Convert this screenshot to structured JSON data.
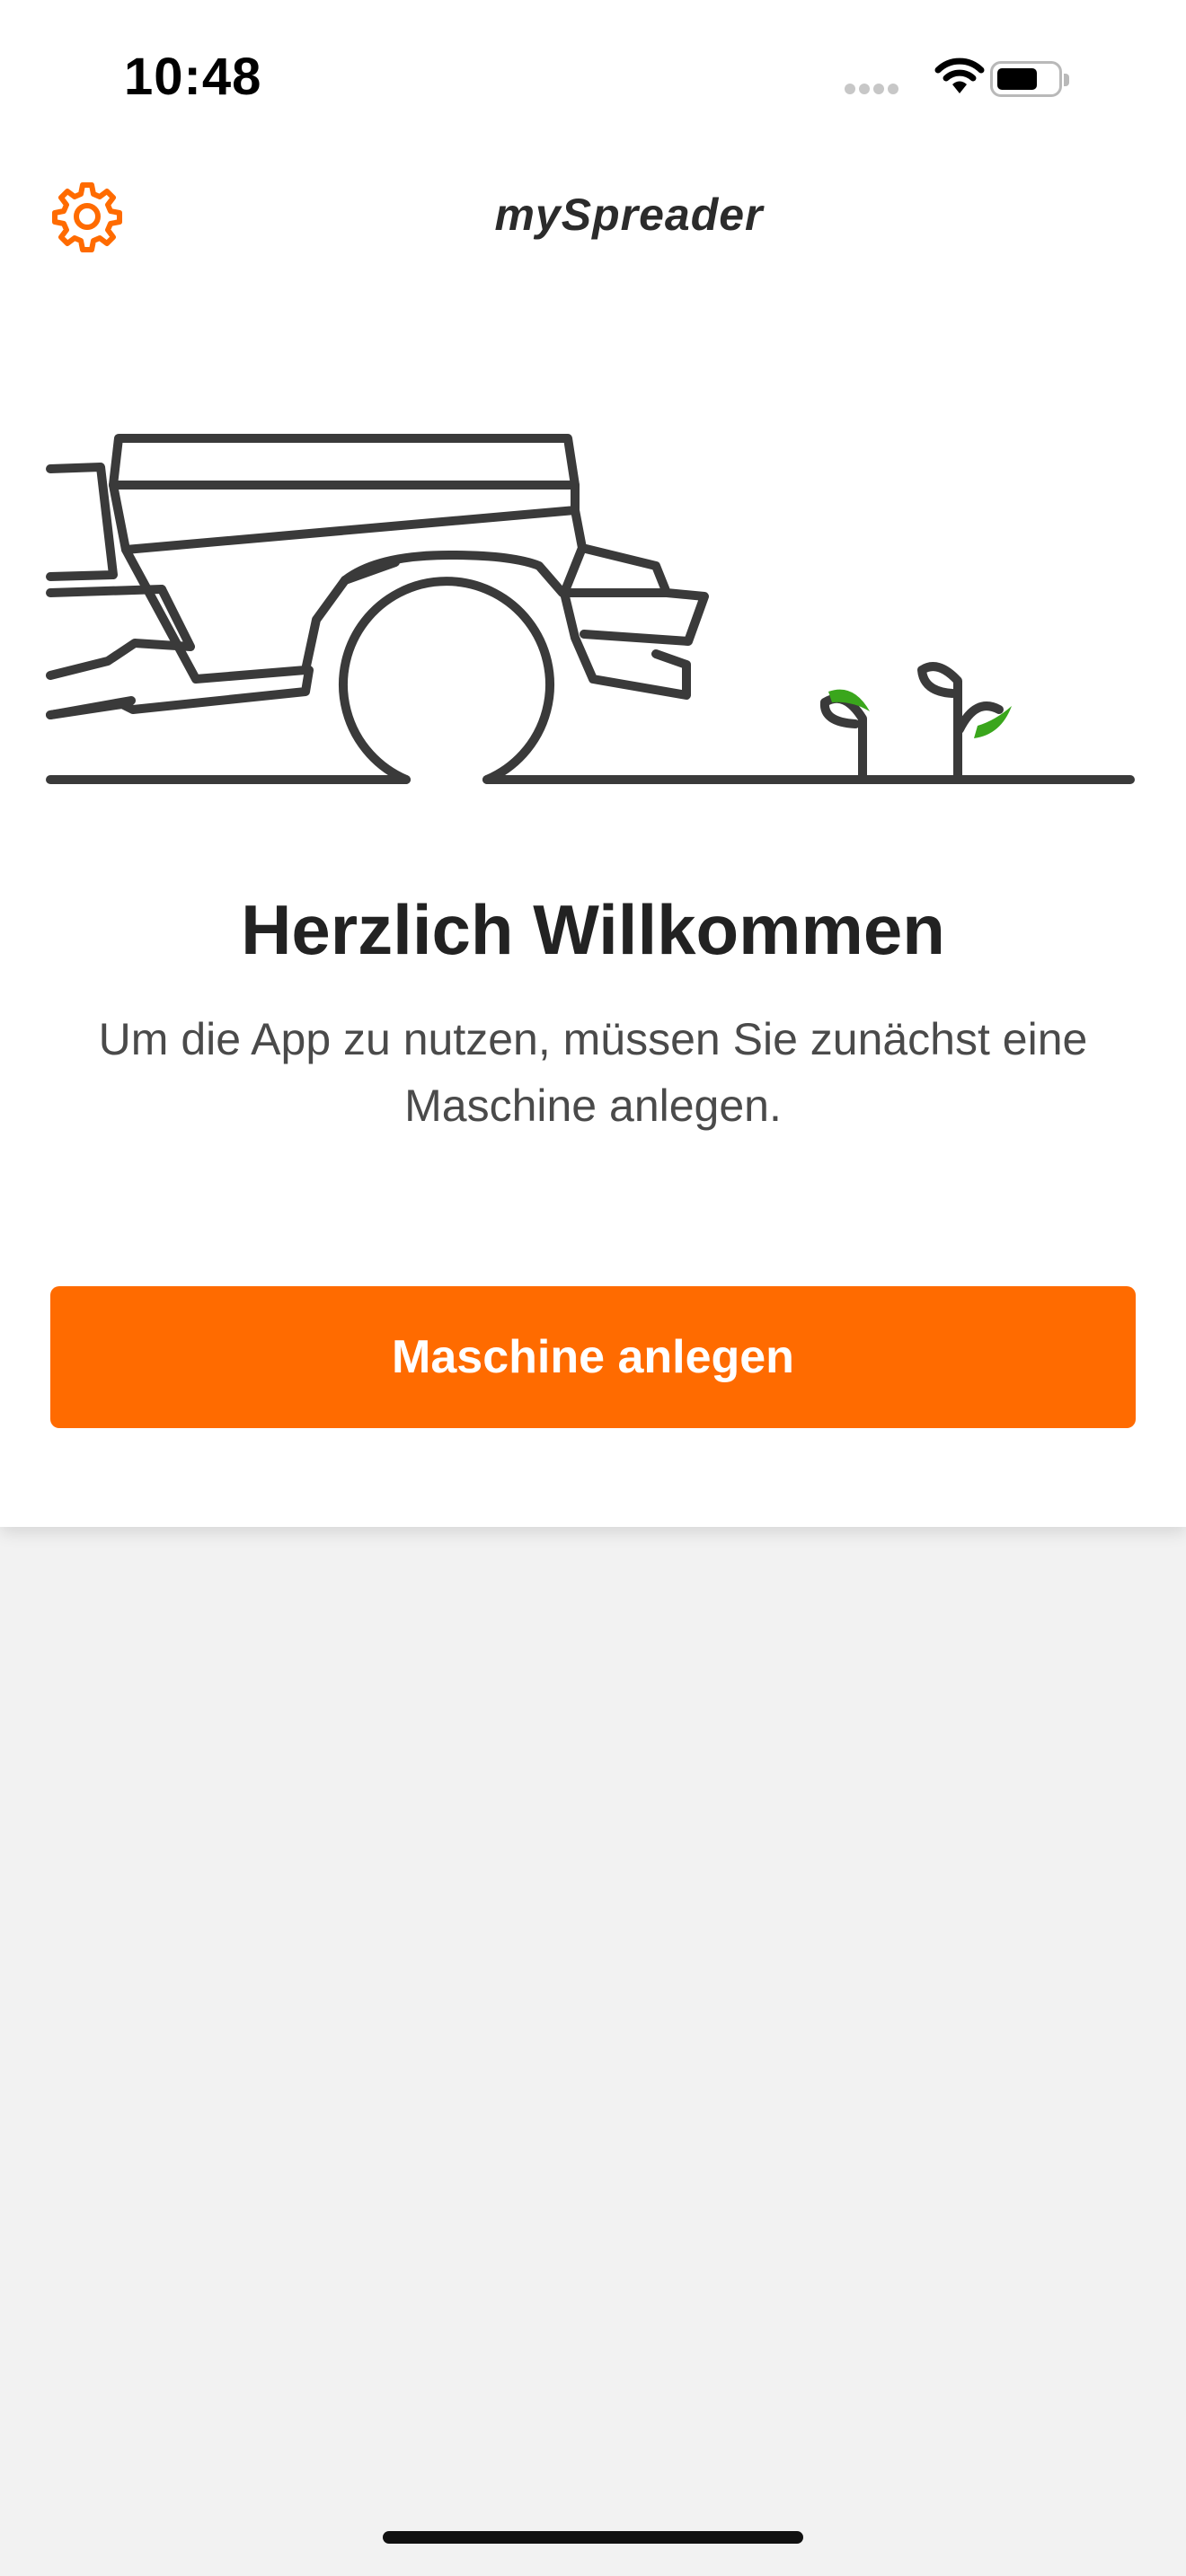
{
  "status_bar": {
    "time": "10:48"
  },
  "header": {
    "title": "mySpreader",
    "settings_icon": "gear-icon"
  },
  "colors": {
    "accent": "#ff6b00",
    "plant_green": "#3aa61c",
    "line": "#3a3a3a",
    "background": "#f2f2f2"
  },
  "welcome": {
    "title": "Herzlich Willkommen",
    "body": "Um die App zu nutzen, müssen Sie zunächst eine Maschine anlegen."
  },
  "actions": {
    "create_machine_label": "Maschine anlegen"
  }
}
